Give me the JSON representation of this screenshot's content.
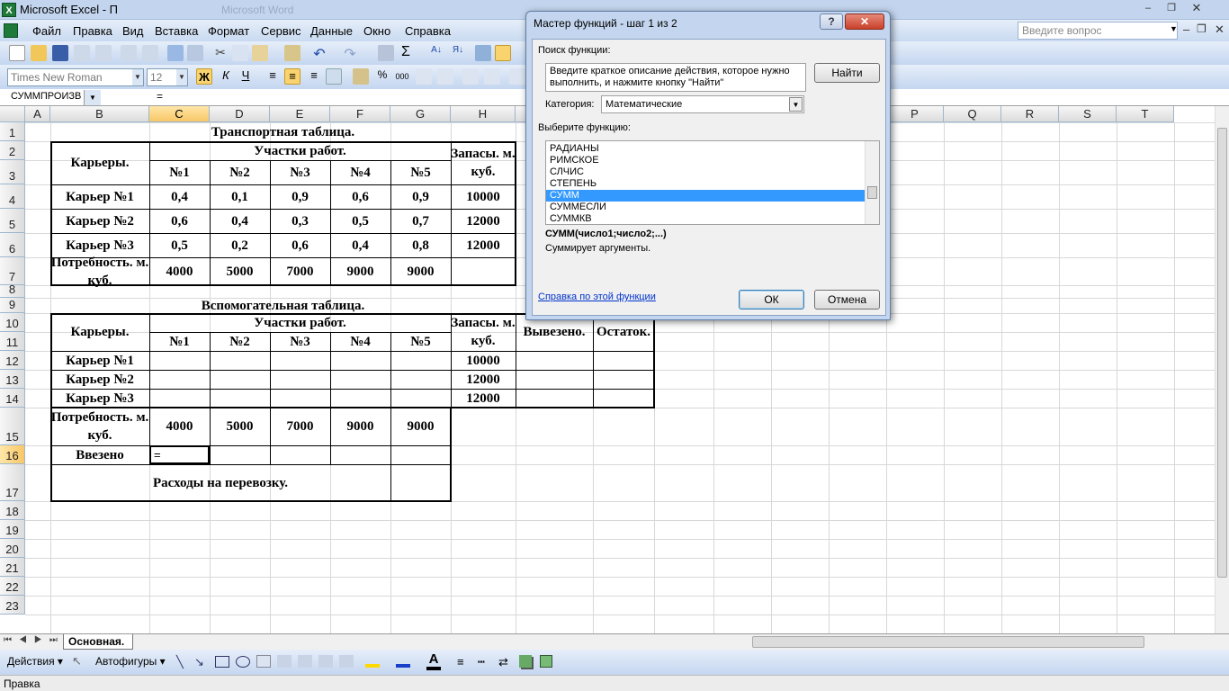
{
  "window": {
    "title": "Microsoft Excel - П",
    "bg_title": "Microsoft Word"
  },
  "menu": [
    "Файл",
    "Правка",
    "Вид",
    "Вставка",
    "Формат",
    "Сервис",
    "Данные",
    "Окно",
    "Справка"
  ],
  "question_placeholder": "Введите вопрос",
  "font": {
    "name": "Times New Roman",
    "size": "12"
  },
  "formula_bar": {
    "name_box": "СУММПРОИЗВ",
    "eq": "="
  },
  "columns": [
    "A",
    "B",
    "C",
    "D",
    "E",
    "F",
    "G",
    "H",
    "I",
    "",
    "",
    "",
    "",
    "O",
    "P",
    "Q",
    "R",
    "S",
    "T"
  ],
  "rows": [
    "1",
    "2",
    "3",
    "4",
    "5",
    "6",
    "7",
    "8",
    "9",
    "10",
    "11",
    "12",
    "13",
    "14",
    "15",
    "16",
    "17",
    "18",
    "19",
    "20",
    "21",
    "22",
    "23"
  ],
  "sheet": {
    "title1": "Транспортная таблица.",
    "careers": "Карьеры.",
    "sites": "Участки работ.",
    "stock": "Запасы. м. куб.",
    "nums": [
      "№1",
      "№2",
      "№3",
      "№4",
      "№5"
    ],
    "t1": [
      {
        "label": "Карьер №1",
        "vals": [
          "0,4",
          "0,1",
          "0,9",
          "0,6",
          "0,9"
        ],
        "stock": "10000"
      },
      {
        "label": "Карьер №2",
        "vals": [
          "0,6",
          "0,4",
          "0,3",
          "0,5",
          "0,7"
        ],
        "stock": "12000"
      },
      {
        "label": "Карьер №3",
        "vals": [
          "0,5",
          "0,2",
          "0,6",
          "0,4",
          "0,8"
        ],
        "stock": "12000"
      }
    ],
    "need": "Потребность. м. куб.",
    "need_vals": [
      "4000",
      "5000",
      "7000",
      "9000",
      "9000"
    ],
    "title2": "Вспомогательная таблица.",
    "exported": "Вывезено.",
    "rest": "Остаток.",
    "t2": [
      {
        "label": "Карьер №1",
        "stock": "10000"
      },
      {
        "label": "Карьер №2",
        "stock": "12000"
      },
      {
        "label": "Карьер №3",
        "stock": "12000"
      }
    ],
    "imported": "Ввезено",
    "active_value": "=",
    "cost": "Расходы на перевозку."
  },
  "sheet_tab": "Основная.",
  "drawbar": {
    "actions": "Действия",
    "autoshapes": "Автофигуры"
  },
  "status": "Правка",
  "dialog": {
    "title": "Мастер функций - шаг 1 из 2",
    "search_label": "Поиск функции:",
    "search_text": "Введите краткое описание действия, которое нужно выполнить, и нажмите кнопку \"Найти\"",
    "find": "Найти",
    "category_label": "Категория:",
    "category": "Математические",
    "select_label": "Выберите функцию:",
    "functions": [
      "РАДИАНЫ",
      "РИМСКОЕ",
      "СЛЧИС",
      "СТЕПЕНЬ",
      "СУММ",
      "СУММЕСЛИ",
      "СУММКВ"
    ],
    "selected_index": 4,
    "signature": "СУММ(число1;число2;...)",
    "description": "Суммирует аргументы.",
    "help": "Справка по этой функции",
    "ok": "ОК",
    "cancel": "Отмена"
  }
}
